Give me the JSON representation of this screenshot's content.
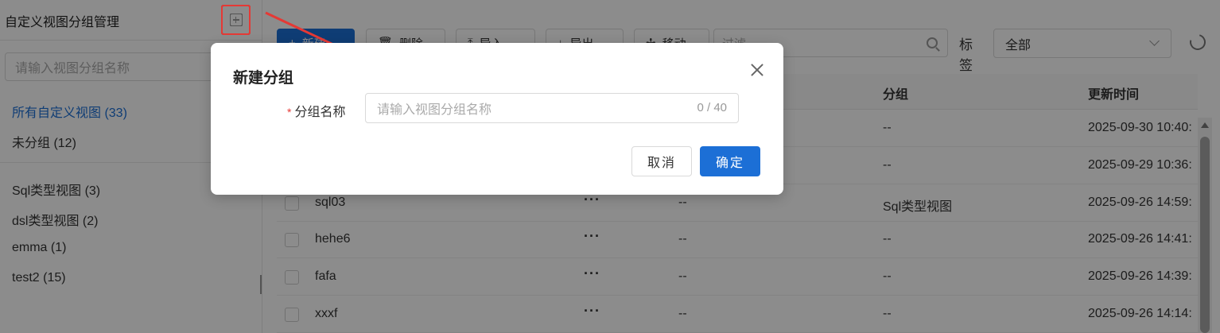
{
  "sidebar": {
    "title": "自定义视图分组管理",
    "search_placeholder": "请输入视图分组名称",
    "groups": [
      {
        "label": "所有自定义视图 (33)"
      },
      {
        "label": "未分组 (12)"
      },
      {
        "label": "Sql类型视图 (3)"
      },
      {
        "label": "dsl类型视图 (2)"
      },
      {
        "label": "emma (1)"
      },
      {
        "label": "test2 (15)"
      }
    ]
  },
  "toolbar": {
    "new_label": "新建",
    "delete_label": "删除",
    "import_label": "导入",
    "export_label": "导出",
    "move_label": "移动",
    "filter_placeholder": "过滤",
    "tag_label": "标签",
    "tag_select_value": "全部"
  },
  "table": {
    "columns": {
      "group": "分组",
      "updated": "更新时间"
    },
    "rows": [
      {
        "name": "",
        "desc": "",
        "group": "--",
        "updated": "2025-09-30 10:40:"
      },
      {
        "name": "",
        "desc": "",
        "group": "--",
        "updated": "2025-09-29 10:36:"
      },
      {
        "name": "sql03",
        "desc": "--",
        "group": "Sql类型视图",
        "updated": "2025-09-26 14:59:"
      },
      {
        "name": "hehe6",
        "desc": "--",
        "group": "--",
        "updated": "2025-09-26 14:41:"
      },
      {
        "name": "fafa",
        "desc": "--",
        "group": "--",
        "updated": "2025-09-26 14:39:"
      },
      {
        "name": "xxxf",
        "desc": "--",
        "group": "--",
        "updated": "2025-09-26 14:14:"
      }
    ],
    "more_glyph": "···"
  },
  "modal": {
    "title": "新建分组",
    "required_mark": "*",
    "field_label": "分组名称",
    "field_placeholder": "请输入视图分组名称",
    "char_count": "0 / 40",
    "cancel_label": "取消",
    "ok_label": "确定"
  },
  "colors": {
    "primary": "#1c6fd6",
    "annotation": "#e53935"
  }
}
